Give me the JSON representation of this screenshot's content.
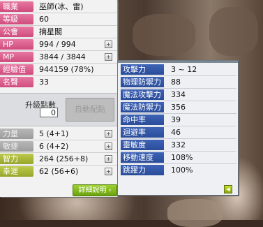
{
  "basic": [
    {
      "label": "職業",
      "value": "巫師(冰、雷)",
      "style": "pink",
      "plus": false
    },
    {
      "label": "等級",
      "value": "60",
      "style": "pink",
      "plus": false
    },
    {
      "label": "公會",
      "value": "摘星閣",
      "style": "pink",
      "plus": false
    },
    {
      "label": "HP",
      "value": "994 / 994",
      "style": "pink",
      "plus": true
    },
    {
      "label": "MP",
      "value": "3844 / 3844",
      "style": "pink",
      "plus": true
    },
    {
      "label": "經驗值",
      "value": "944159 (78%)",
      "style": "pink",
      "plus": false
    },
    {
      "label": "名聲",
      "value": "33",
      "style": "pink",
      "plus": false
    }
  ],
  "ability_points": {
    "title": "升級點數",
    "value": "0",
    "auto_label": "自動配點"
  },
  "stats": [
    {
      "label": "力量",
      "value": "5 (4+1)",
      "style": "grey"
    },
    {
      "label": "敏捷",
      "value": "6 (4+2)",
      "style": "grey"
    },
    {
      "label": "智力",
      "value": "264 (256+8)",
      "style": "olive"
    },
    {
      "label": "幸運",
      "value": "62 (56+6)",
      "style": "olive"
    }
  ],
  "detail_button": "詳細說明 ›",
  "details": [
    {
      "label": "攻擊力",
      "value": "3 ~ 12"
    },
    {
      "label": "物理防禦力",
      "value": "88"
    },
    {
      "label": "魔法攻擊力",
      "value": "334"
    },
    {
      "label": "魔法防禦力",
      "value": "356"
    },
    {
      "label": "命中率",
      "value": "39"
    },
    {
      "label": "迴避率",
      "value": "46"
    },
    {
      "label": "靈敏度",
      "value": "332"
    },
    {
      "label": "移動速度",
      "value": "108%"
    },
    {
      "label": "跳躍力",
      "value": "100%"
    }
  ],
  "close_arrow": "◀"
}
